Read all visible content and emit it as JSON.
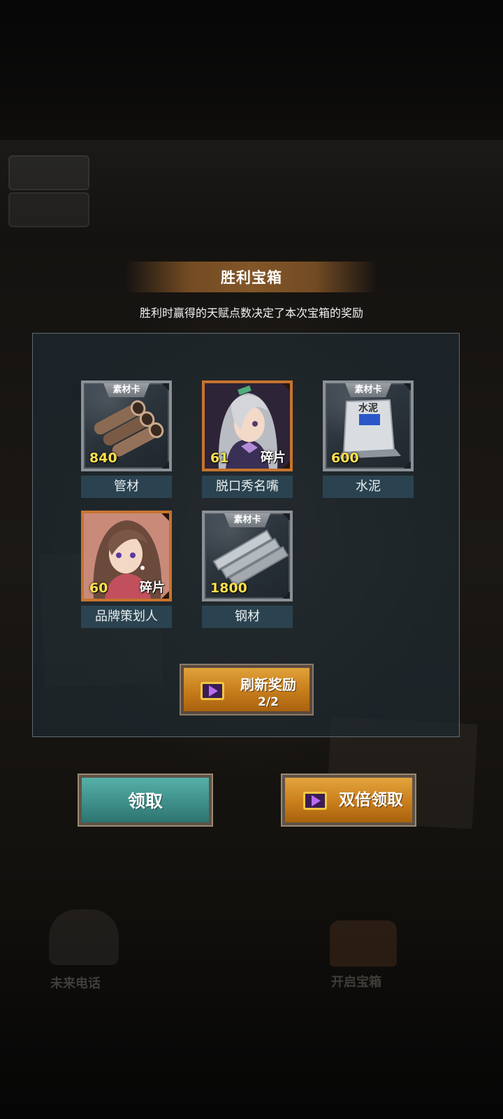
{
  "background": {
    "labels": [
      "未来电话",
      "开启宝箱"
    ]
  },
  "modal": {
    "title": "胜利宝箱",
    "subtitle": "胜利时赢得的天赋点数决定了本次宝箱的奖励"
  },
  "rewards": [
    {
      "kind": "material",
      "tag": "素材卡",
      "qty": "840",
      "name": "管材",
      "icon": "pipes-icon"
    },
    {
      "kind": "character",
      "qty": "61",
      "fragment": "碎片",
      "name": "脱口秀名嘴",
      "icon": "silver-hair-girl-portrait"
    },
    {
      "kind": "material",
      "tag": "素材卡",
      "qty": "600",
      "name": "水泥",
      "icon": "cement-bag-icon",
      "icon_text": "水泥"
    },
    {
      "kind": "character",
      "qty": "60",
      "fragment": "碎片",
      "name": "品牌策划人",
      "icon": "brown-hair-girl-portrait"
    },
    {
      "kind": "material",
      "tag": "素材卡",
      "qty": "1800",
      "name": "钢材",
      "icon": "steel-plates-icon"
    }
  ],
  "refresh_button": {
    "label": "刷新奖励",
    "count": "2/2",
    "icon": "video-play-icon"
  },
  "claim_button": {
    "label": "领取"
  },
  "double_button": {
    "label": "双倍领取",
    "icon": "video-play-icon"
  },
  "colors": {
    "material_border": "#8a9096",
    "character_border": "#c7742e",
    "qty_yellow": "#ffe14a",
    "name_bg": "#2b4350",
    "claim_teal": "#3f8f8a",
    "gold_button": "#c97e1c"
  }
}
